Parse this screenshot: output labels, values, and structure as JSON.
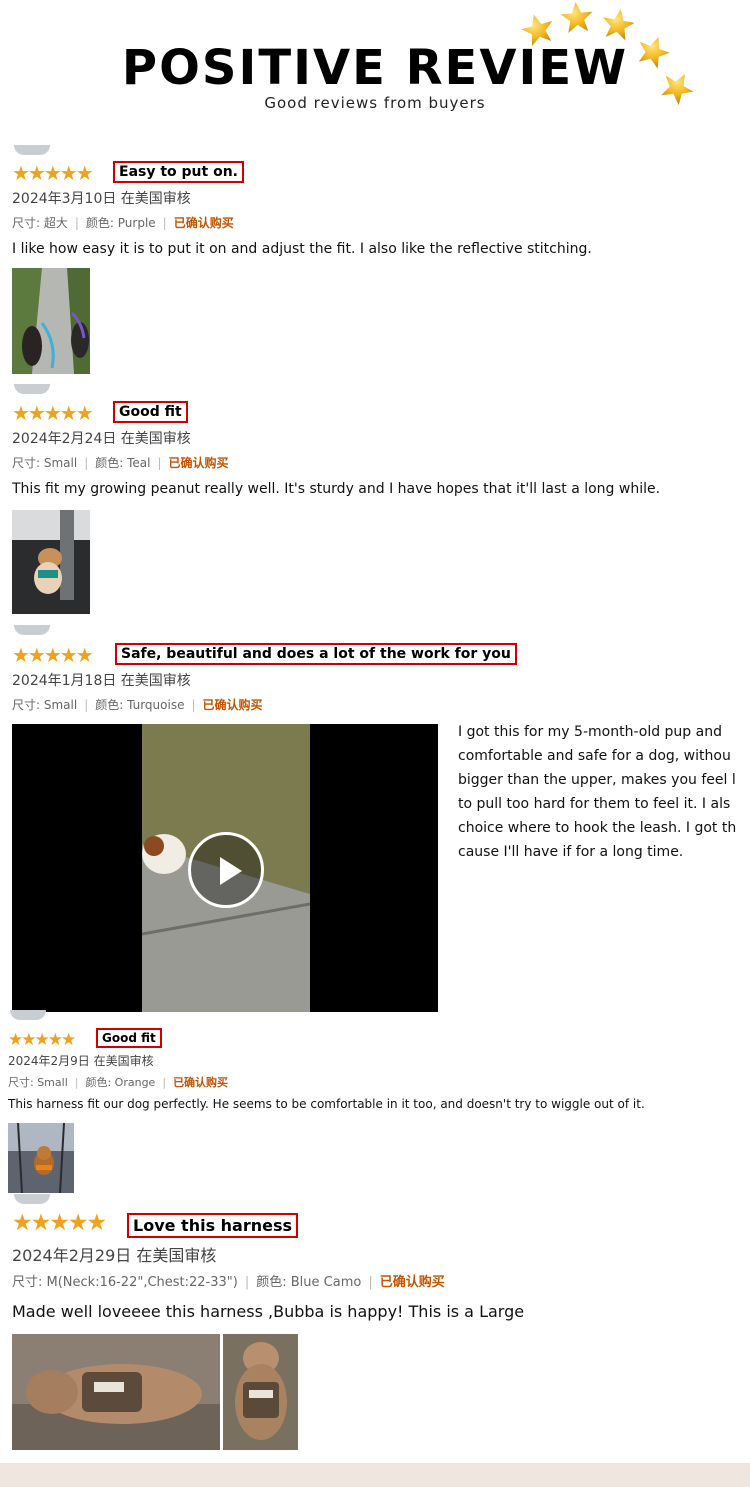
{
  "header": {
    "title": "POSITIVE REVIEW",
    "subtitle": "Good reviews from buyers",
    "star_icon": "gold-star-icon",
    "colors": {
      "gold": "#f2b51c",
      "title": "#000000"
    }
  },
  "colors": {
    "rating_star": "#f0a21a",
    "title_box_border": "#d10000",
    "verified": "#c45500",
    "footer_band": "#efe6df"
  },
  "reviews": [
    {
      "stars": "★★★★★",
      "rating": 5,
      "title": "Easy to put on.",
      "date": "2024年3月10日 在美国审核",
      "size": "尺寸: 超大",
      "color": "颜色: Purple",
      "verified": "已确认购买",
      "body": "I like how easy it is to put it on and adjust the fit. I also like the reflective stitching."
    },
    {
      "stars": "★★★★★",
      "rating": 5,
      "title": "Good fit",
      "date": "2024年2月24日 在美国审核",
      "size": "尺寸: Small",
      "color": "颜色: Teal",
      "verified": "已确认购买",
      "body": "This fit my growing peanut really well. It's sturdy and I have hopes that it'll last a long while."
    },
    {
      "stars": "★★★★★",
      "rating": 5,
      "title": "Safe, beautiful and does a lot of the work for you",
      "date": "2024年1月18日 在美国审核",
      "size": "尺寸: Small",
      "color": "颜色: Turquoise",
      "verified": "已确认购买",
      "body_lines": [
        "I got this for my 5-month-old pup and",
        "comfortable and safe for a dog, withou",
        "bigger than the upper, makes you feel l",
        "to pull too hard for them to feel it. I als",
        "choice where to hook the leash. I got th",
        "cause I'll have if for a long time."
      ]
    },
    {
      "stars": "★★★★★",
      "rating": 5,
      "title": "Good fit",
      "date": "2024年2月9日 在美国审核",
      "size": "尺寸: Small",
      "color": "颜色: Orange",
      "verified": "已确认购买",
      "body": "This harness fit our dog perfectly. He seems to be comfortable in it too, and doesn't try to wiggle out of it."
    },
    {
      "stars": "★★★★★",
      "rating": 5,
      "title": "Love this harness",
      "date": "2024年2月29日 在美国审核",
      "size": "尺寸: M(Neck:16-22\",Chest:22-33\")",
      "color": "颜色: Blue Camo",
      "verified": "已确认购买",
      "body": "Made well loveeee this harness ,Bubba is happy! This is a Large"
    }
  ]
}
